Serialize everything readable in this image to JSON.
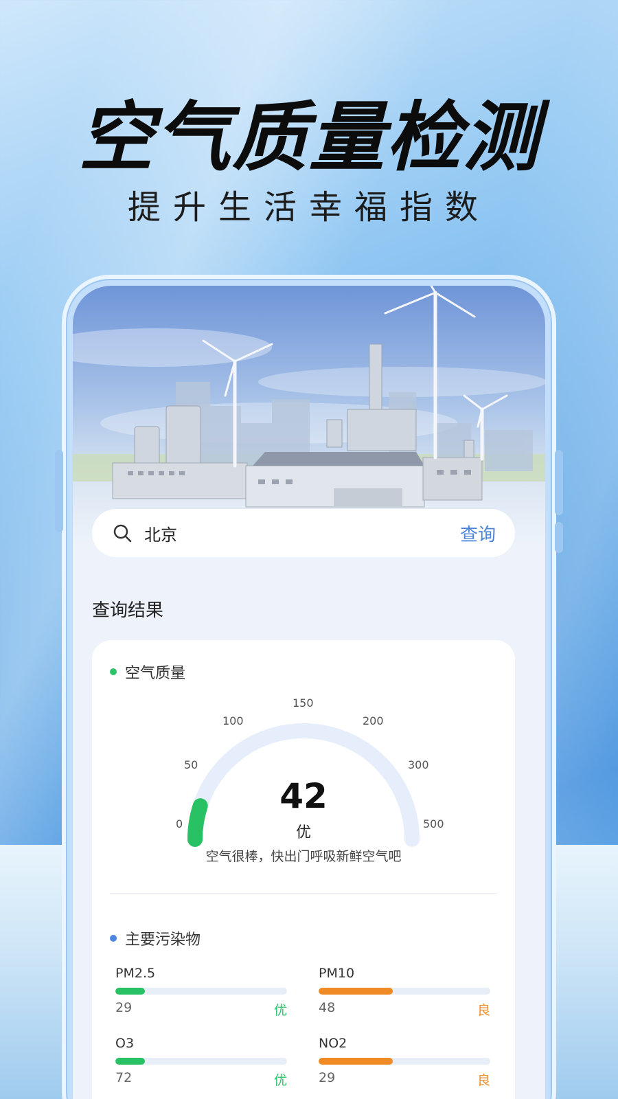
{
  "promo": {
    "headline": "空气质量检测",
    "subline": "提升生活幸福指数"
  },
  "search": {
    "icon": "search-icon",
    "value": "北京",
    "button_label": "查询"
  },
  "results": {
    "title": "查询结果"
  },
  "air_quality": {
    "section_label": "空气质量",
    "section_dot_color": "#2ec26a",
    "aqi_value": "42",
    "aqi_level": "优",
    "tip": "空气很棒，快出门呼吸新鲜空气吧",
    "gauge_max": 500,
    "gauge_fill_fraction": 0.1,
    "gauge_color": "#28c163",
    "ticks": [
      "0",
      "50",
      "100",
      "150",
      "200",
      "300",
      "500"
    ]
  },
  "pollutants": {
    "section_label": "主要污染物",
    "section_dot_color": "#4d85e0",
    "items": [
      {
        "name": "PM2.5",
        "value": "29",
        "level": "优",
        "level_color": "#2ec26a",
        "bar_color": "#28c163",
        "bar_fraction": 0.17
      },
      {
        "name": "PM10",
        "value": "48",
        "level": "良",
        "level_color": "#f08a24",
        "bar_color": "#f08a24",
        "bar_fraction": 0.43
      },
      {
        "name": "O3",
        "value": "72",
        "level": "优",
        "level_color": "#2ec26a",
        "bar_color": "#28c163",
        "bar_fraction": 0.17
      },
      {
        "name": "NO2",
        "value": "29",
        "level": "良",
        "level_color": "#f08a24",
        "bar_color": "#f08a24",
        "bar_fraction": 0.43
      }
    ]
  }
}
